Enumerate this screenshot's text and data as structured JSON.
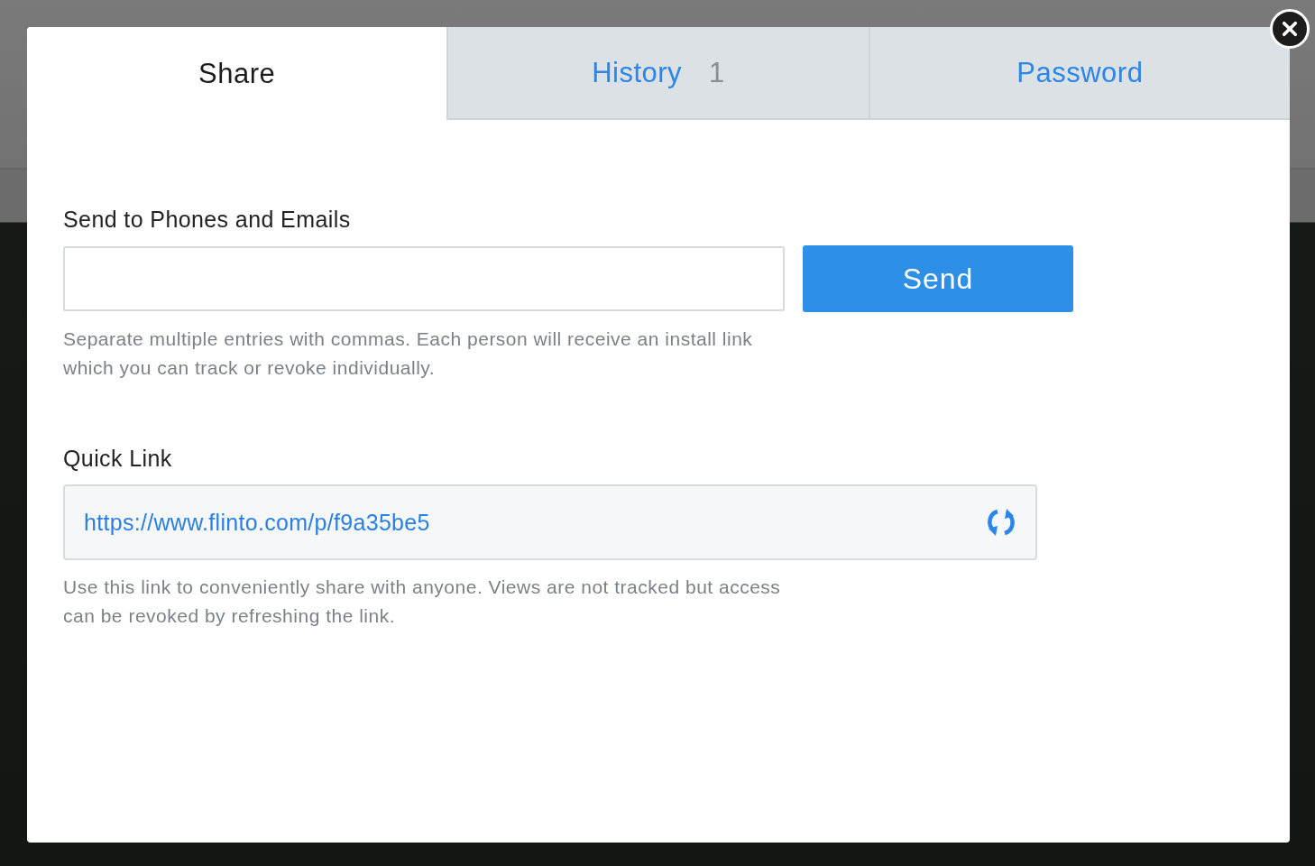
{
  "tabs": [
    {
      "label": "Share",
      "selected": true
    },
    {
      "label": "History",
      "count": "1",
      "selected": false
    },
    {
      "label": "Password",
      "selected": false
    }
  ],
  "send": {
    "label": "Send to Phones and Emails",
    "button": "Send",
    "help": "Separate multiple entries with commas. Each person will receive an install link which you can track or revoke individually."
  },
  "quick_link": {
    "label": "Quick Link",
    "url": "https://www.flinto.com/p/f9a35be5",
    "help": "Use this link to conveniently share with anyone. Views are not tracked but access can be revoked by refreshing the link."
  }
}
